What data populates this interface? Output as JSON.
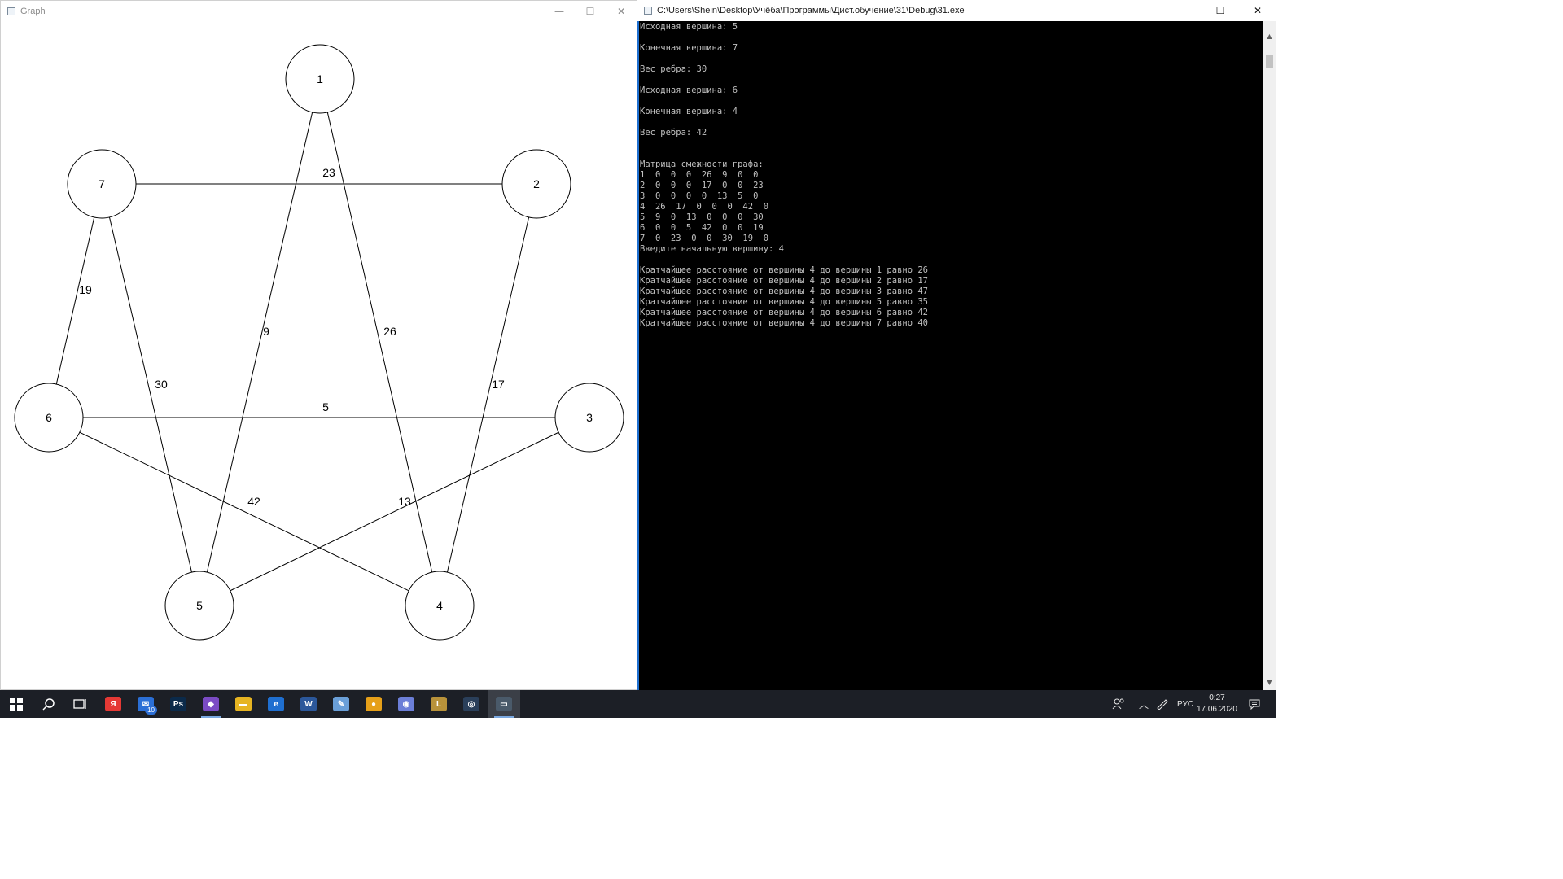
{
  "graph_window": {
    "title": "Graph",
    "nodes": [
      {
        "label": "1"
      },
      {
        "label": "2"
      },
      {
        "label": "3"
      },
      {
        "label": "4"
      },
      {
        "label": "5"
      },
      {
        "label": "6"
      },
      {
        "label": "7"
      }
    ],
    "edges": [
      {
        "from": "7",
        "to": "2",
        "weight": "23"
      },
      {
        "from": "1",
        "to": "5",
        "weight": "9"
      },
      {
        "from": "1",
        "to": "4",
        "weight": "26"
      },
      {
        "from": "7",
        "to": "6",
        "weight": "19"
      },
      {
        "from": "7",
        "to": "5",
        "weight": "30"
      },
      {
        "from": "2",
        "to": "4",
        "weight": "17"
      },
      {
        "from": "6",
        "to": "3",
        "weight": "5"
      },
      {
        "from": "6",
        "to": "4",
        "weight": "42"
      },
      {
        "from": "3",
        "to": "5",
        "weight": "13"
      }
    ]
  },
  "console_window": {
    "title": "C:\\Users\\Shein\\Desktop\\Учёба\\Программы\\Дист.обучение\\31\\Debug\\31.exe",
    "lines": [
      "Исходная вершина: 5",
      "",
      "Конечная вершина: 7",
      "",
      "Вес ребра: 30",
      "",
      "Исходная вершина: 6",
      "",
      "Конечная вершина: 4",
      "",
      "Вес ребра: 42",
      "",
      "",
      "Матрица смежности графа:",
      "1  0  0  0  26  9  0  0",
      "2  0  0  0  17  0  0  23",
      "3  0  0  0  0  13  5  0",
      "4  26  17  0  0  0  42  0",
      "5  9  0  13  0  0  0  30",
      "6  0  0  5  42  0  0  19",
      "7  0  23  0  0  30  19  0",
      "Введите начальную вершину: 4",
      "",
      "Кратчайшее расстояние от вершины 4 до вершины 1 равно 26",
      "Кратчайшее расстояние от вершины 4 до вершины 2 равно 17",
      "Кратчайшее расстояние от вершины 4 до вершины 3 равно 47",
      "Кратчайшее расстояние от вершины 4 до вершины 5 равно 35",
      "Кратчайшее расстояние от вершины 4 до вершины 6 равно 42",
      "Кратчайшее расстояние от вершины 4 до вершины 7 равно 40"
    ]
  },
  "window_controls": {
    "minimize": "—",
    "maximize": "☐",
    "close": "✕"
  },
  "taskbar": {
    "apps": [
      {
        "name": "yandex-browser-icon",
        "glyph": "Я",
        "color": "#e53935"
      },
      {
        "name": "mail-icon",
        "glyph": "✉",
        "color": "#2b6fd6",
        "badge": "10"
      },
      {
        "name": "photoshop-icon",
        "glyph": "Ps",
        "color": "#0b2a4a"
      },
      {
        "name": "visual-studio-icon",
        "glyph": "◆",
        "color": "#7b4bc4"
      },
      {
        "name": "file-explorer-icon",
        "glyph": "▬",
        "color": "#e6b422"
      },
      {
        "name": "edge-icon",
        "glyph": "e",
        "color": "#1f6fd0"
      },
      {
        "name": "word-icon",
        "glyph": "W",
        "color": "#2b579a"
      },
      {
        "name": "paint-icon",
        "glyph": "✎",
        "color": "#6a9fd8"
      },
      {
        "name": "chrome-icon",
        "glyph": "●",
        "color": "#e6a019"
      },
      {
        "name": "discord-icon",
        "glyph": "◉",
        "color": "#6c7fd8"
      },
      {
        "name": "league-icon",
        "glyph": "L",
        "color": "#b8923a"
      },
      {
        "name": "steam-icon",
        "glyph": "◎",
        "color": "#2a3f5a"
      },
      {
        "name": "console-app-icon",
        "glyph": "▭",
        "color": "#4a5a6a"
      }
    ],
    "language": "РУС",
    "time": "0:27",
    "date": "17.06.2020"
  }
}
